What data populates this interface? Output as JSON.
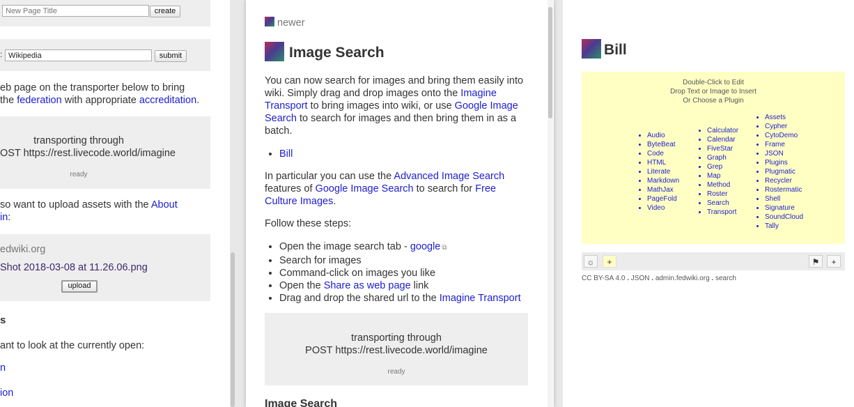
{
  "left_page": {
    "new_page_input_placeholder": "New Page Title",
    "create_button": "create",
    "wiki_label_suffix": ":",
    "wiki_input_value": "Wikipedia",
    "submit_button": "submit",
    "para1_line1": "eb page on the transporter below to bring",
    "para1_line2_pre": "the ",
    "para1_link_federation": "federation",
    "para1_line2_mid": " with appropriate ",
    "para1_link_accreditation": "accreditation",
    "para1_line2_end": ".",
    "transport_line1": "transporting through",
    "transport_line2": "OST https://rest.livecode.world/imagine",
    "transport_status": "ready",
    "para2_line1_pre": "so want to upload assets with the ",
    "para2_link_about": "About",
    "para2_line2_link": "in",
    "para2_line2_end": ":",
    "assets_site": "edwiki.org",
    "assets_file": "Shot 2018-03-08 at 11.26.06.png",
    "upload_button": "upload",
    "heading_partial": "s",
    "para3": "ant to look at the currently open:",
    "link_partial_1": "n",
    "link_partial_2": "ion"
  },
  "middle_page": {
    "newer_link": "newer",
    "title": "Image Search",
    "para1_pre": "You can now search for images and bring them easily into wiki. Simply drag and drop images onto the ",
    "para1_link1": "Imagine Transport",
    "para1_mid": " to bring images into wiki, or use ",
    "para1_link2": "Google Image Search",
    "para1_end": " to search for images and then bring them in as a batch.",
    "bill_link": "Bill",
    "para2_pre": "In particular you can use the ",
    "para2_link1": "Advanced Image Search",
    "para2_mid": " features of ",
    "para2_link2": "Google Image Search",
    "para2_mid2": " to search for ",
    "para2_link3": "Free Culture Images",
    "para2_end": ".",
    "steps_intro": "Follow these steps:",
    "steps": {
      "s1_pre": "Open the image search tab - ",
      "s1_link": "google",
      "s2": "Search for images",
      "s3": "Command-click on images you like",
      "s4_pre": "Open the ",
      "s4_link": "Share as web page",
      "s4_end": " link",
      "s5_pre": "Drag and drop the shared url to the ",
      "s5_link": "Imagine Transport"
    },
    "transport_line1": "transporting through",
    "transport_line2": "POST https://rest.livecode.world/imagine",
    "transport_status": "ready",
    "bottom_heading": "Image Search"
  },
  "right_page": {
    "title": "Bill",
    "factory_hint_1": "Double-Click to Edit",
    "factory_hint_2": "Drop Text or Image to Insert",
    "factory_hint_3": "Or Choose a Plugin",
    "plugins_col1": [
      "Audio",
      "ByteBeat",
      "Code",
      "HTML",
      "Literate",
      "Markdown",
      "MathJax",
      "PageFold",
      "Video"
    ],
    "plugins_col2": [
      "Calculator",
      "Calendar",
      "FiveStar",
      "Graph",
      "Grep",
      "Map",
      "Method",
      "Roster",
      "Search",
      "Transport"
    ],
    "plugins_col3": [
      "Assets",
      "Cypher",
      "CytoDemo",
      "Frame",
      "JSON",
      "Plugins",
      "Plugmatic",
      "Recycler",
      "Rostermatic",
      "Shell",
      "Signature",
      "SoundCloud",
      "Tally"
    ],
    "footer_icons": {
      "gear": "☼",
      "add": "+",
      "flag": "⚑",
      "add_right": "+"
    },
    "license": "CC BY-SA 4.0",
    "license_sep": ".",
    "json_link": "JSON",
    "site_link": "admin.fedwiki.org",
    "search_link": "search"
  }
}
